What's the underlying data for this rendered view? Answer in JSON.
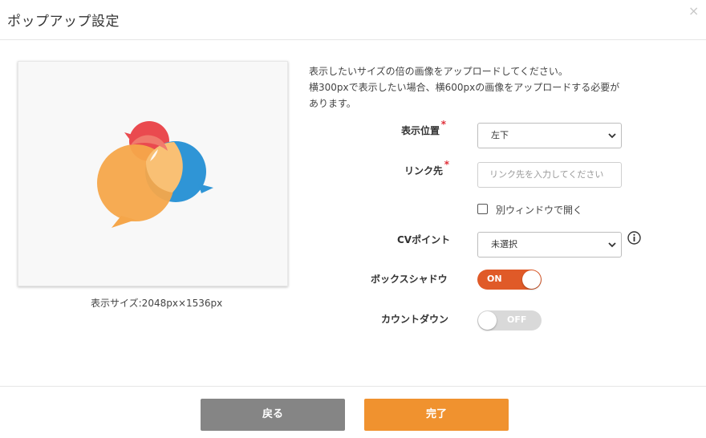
{
  "header": {
    "title": "ポップアップ設定",
    "close_glyph": "×"
  },
  "preview": {
    "size_caption": "表示サイズ:2048px×1536px"
  },
  "description": {
    "line1": "表示したいサイズの倍の画像をアップロードしてください。",
    "line2": "横300pxで表示したい場合、横600pxの画像をアップロードする必要が",
    "line3": "あります。"
  },
  "form": {
    "position": {
      "label": "表示位置",
      "required_mark": "*",
      "value": "左下"
    },
    "link": {
      "label": "リンク先",
      "required_mark": "*",
      "placeholder": "リンク先を入力してください"
    },
    "new_window": {
      "label": "別ウィンドウで開く",
      "checked": false
    },
    "cv_point": {
      "label": "CVポイント",
      "value": "未選択",
      "info_icon": "info-icon"
    },
    "box_shadow": {
      "label": "ボックスシャドウ",
      "state": "ON"
    },
    "countdown": {
      "label": "カウントダウン",
      "state": "OFF"
    }
  },
  "footer": {
    "back_label": "戻る",
    "done_label": "完了"
  },
  "colors": {
    "accent_orange": "#f0922f",
    "toggle_on": "#e05a28",
    "back_gray": "#858585",
    "required_red": "#e0303a"
  }
}
